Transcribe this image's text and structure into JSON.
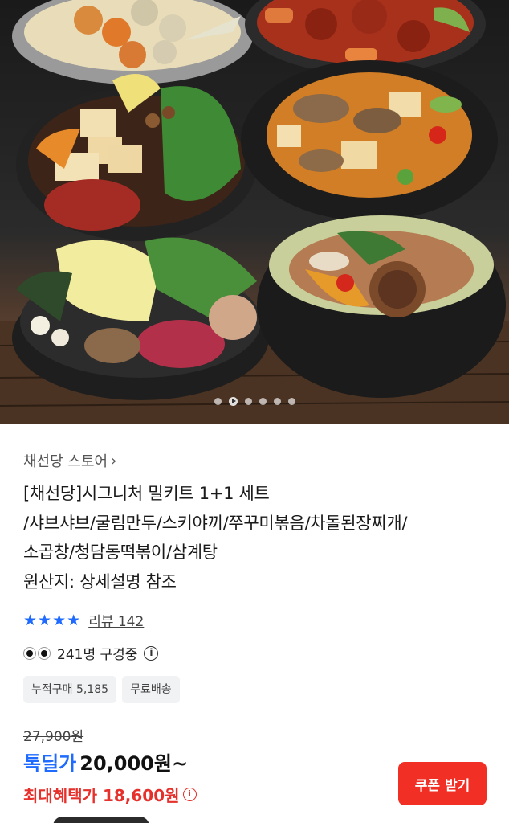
{
  "store": {
    "name": "채선당 스토어",
    "chevron_icon": "chevron-right-icon"
  },
  "product": {
    "title_lines": [
      "[채선당]시그니처 밀키트 1+1 세트",
      "/샤브샤브/굴림만두/스키야끼/쭈꾸미볶음/차돌된장찌개/",
      "소곱창/청담동떡볶이/삼계탕",
      "원산지: 상세설명 참조"
    ]
  },
  "carousel": {
    "total_dots": 6,
    "current_dot": 2
  },
  "rating": {
    "star_count": 4,
    "star_color": "#1f6bff",
    "review_label": "리뷰 142"
  },
  "viewing": {
    "text": "241명 구경중"
  },
  "tags": [
    "누적구매 5,185",
    "무료배송"
  ],
  "price": {
    "original": "27,900원",
    "deal_label": "톡딜가",
    "deal_price": "20,000원~",
    "max_benefit": "최대혜택가 18,600원",
    "deal_color": "#1f6bff",
    "max_color": "#e5302b"
  },
  "coupon_button": {
    "label": "쿠폰 받기",
    "color": "#f12f24"
  }
}
